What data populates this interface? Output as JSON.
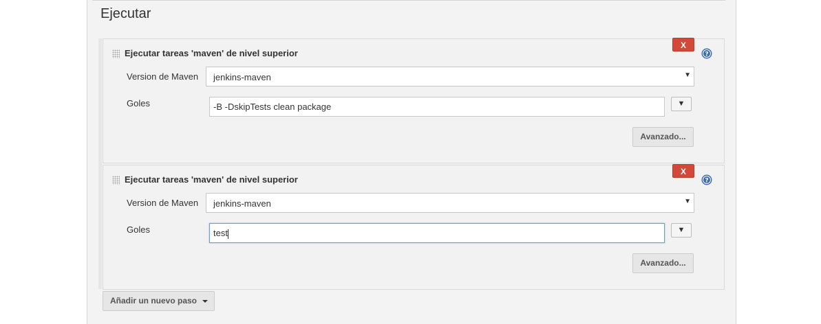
{
  "section": {
    "title": "Ejecutar"
  },
  "steps": [
    {
      "title": "Ejecutar tareas 'maven' de nivel superior",
      "delete_label": "X",
      "help_icon": "question-circle-icon",
      "version_label": "Version de Maven",
      "version_value": "jenkins-maven",
      "goals_label": "Goles",
      "goals_value": "-B -DskipTests clean package",
      "expand_label": "▼",
      "advanced_label": "Avanzado..."
    },
    {
      "title": "Ejecutar tareas 'maven' de nivel superior",
      "delete_label": "X",
      "help_icon": "question-circle-icon",
      "version_label": "Version de Maven",
      "version_value": "jenkins-maven",
      "goals_label": "Goles",
      "goals_value": "test",
      "expand_label": "▼",
      "advanced_label": "Avanzado..."
    }
  ],
  "add_step": {
    "label": "Añadir un nuevo paso"
  },
  "colors": {
    "delete_button": "#d24939",
    "help_icon": "#3b6db3",
    "focus_border": "#6b9de3"
  }
}
